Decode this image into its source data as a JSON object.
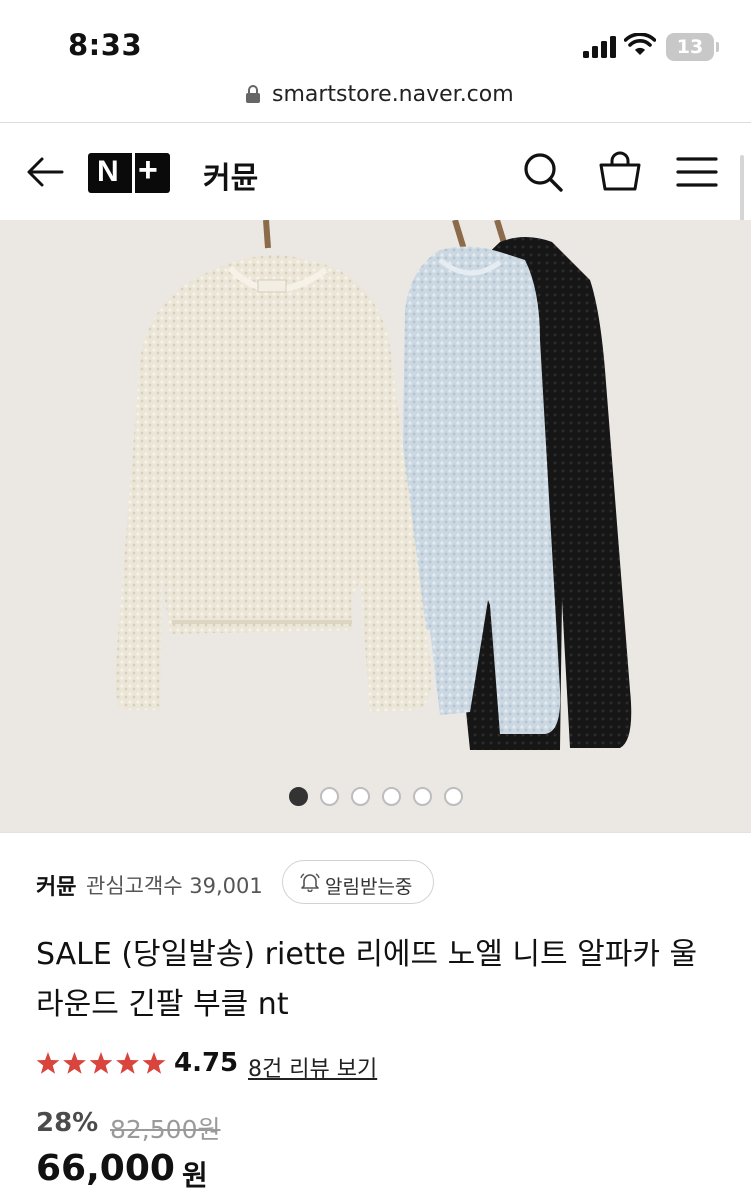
{
  "status_bar": {
    "time": "8:33",
    "battery": "13"
  },
  "browser": {
    "url": "smartstore.naver.com"
  },
  "header": {
    "logo_n": "N",
    "logo_plus": "+",
    "store_name": "커뮨"
  },
  "gallery": {
    "total_images": 6,
    "active_index": 0
  },
  "store_info": {
    "name": "커뮨",
    "followers_label": "관심고객수 39,001",
    "alert_button": "알림받는중"
  },
  "product": {
    "title": "SALE (당일발송) riette 리에뜨 노엘 니트 알파카 울 라운드 긴팔 부클 nt",
    "rating": "4.75",
    "rating_value": 4.75,
    "review_link": "8건 리뷰 보기",
    "discount": "28%",
    "original_price": "82,500원",
    "price": "66,000",
    "price_unit": "원"
  },
  "colors": {
    "star": "#d9453d",
    "dot_active": "#333333",
    "sweater_cream": "#e9e4d6",
    "sweater_blue": "#c9d6e0",
    "sweater_black": "#1b1b1b"
  },
  "icons": [
    "back-arrow-icon",
    "search-icon",
    "cart-icon",
    "menu-icon",
    "lock-icon",
    "bell-icon",
    "star-icon"
  ]
}
